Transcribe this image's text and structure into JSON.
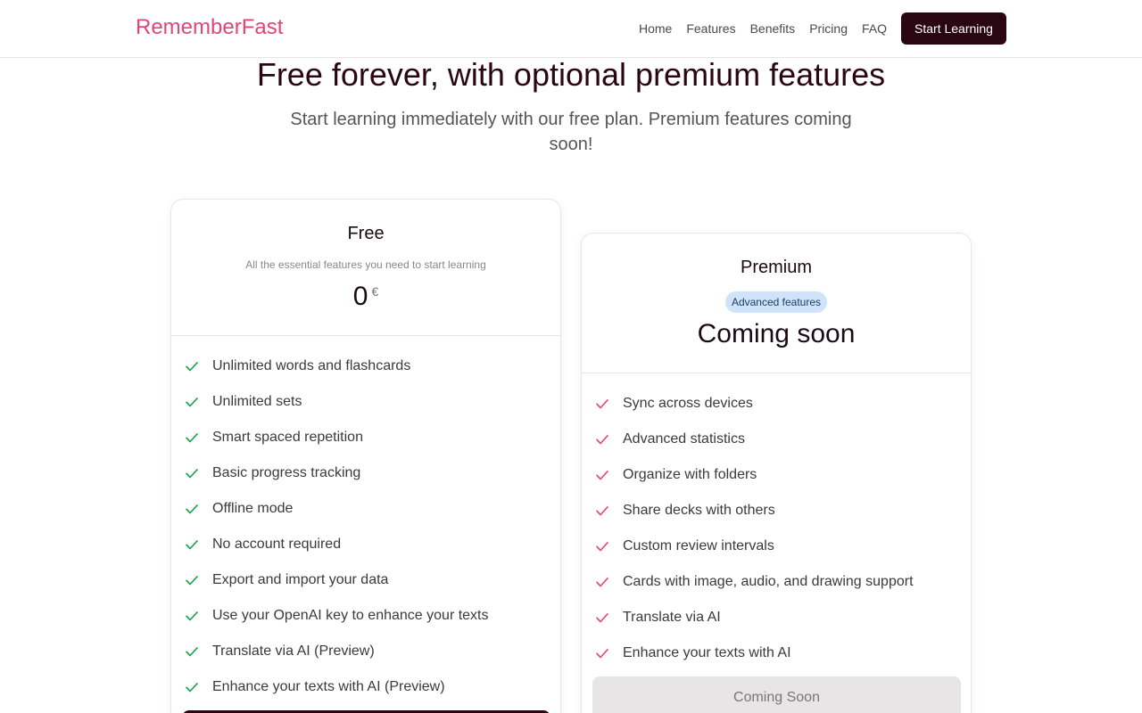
{
  "nav": {
    "logo": "RememberFast",
    "links": [
      "Home",
      "Features",
      "Benefits",
      "Pricing",
      "FAQ"
    ],
    "cta": "Start Learning"
  },
  "hero": {
    "title": "Free forever, with optional premium features",
    "subtitle": "Start learning immediately with our free plan. Premium features coming soon!"
  },
  "free": {
    "name": "Free",
    "description": "All the essential features you need to start learning",
    "price": "0",
    "currency": "€",
    "features": [
      "Unlimited words and flashcards",
      "Unlimited sets",
      "Smart spaced repetition",
      "Basic progress tracking",
      "Offline mode",
      "No account required",
      "Export and import your data",
      "Use your OpenAI key to enhance your texts",
      "Translate via AI (Preview)",
      "Enhance your texts with AI (Preview)"
    ],
    "check_color": "#16a34a"
  },
  "premium": {
    "name": "Premium",
    "badge": "Advanced features",
    "status": "Coming soon",
    "features": [
      "Sync across devices",
      "Advanced statistics",
      "Organize with folders",
      "Share decks with others",
      "Custom review intervals",
      "Cards with image, audio, and drawing support",
      "Translate via AI",
      "Enhance your texts with AI"
    ],
    "button": "Coming Soon",
    "check_color": "#e0457b"
  }
}
